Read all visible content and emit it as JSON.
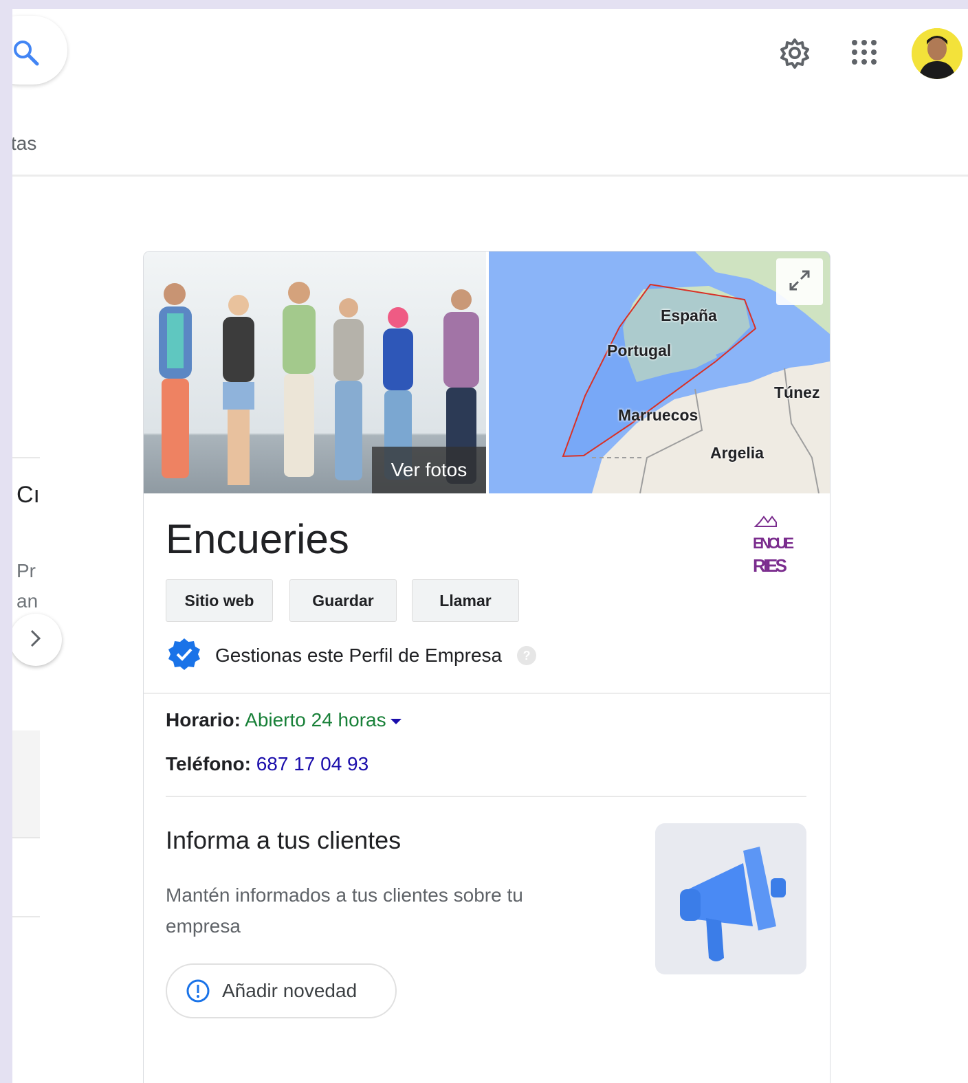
{
  "header": {
    "search_icon": "search-icon",
    "settings_icon": "gear-icon",
    "apps_icon": "apps-grid-icon",
    "tab_fragment": "tas"
  },
  "left_column": {
    "heading_fragment": "Cı",
    "line1_fragment": "Pr",
    "line2_fragment": "an",
    "next_icon": "chevron-right-icon"
  },
  "panel": {
    "photos_label": "Ver fotos",
    "map": {
      "labels": [
        "España",
        "Portugal",
        "Marruecos",
        "Túnez",
        "Argelia"
      ],
      "area_outline_color": "#d93025",
      "expand_icon": "expand-icon"
    },
    "business_name": "Encueries",
    "logo_text_top": "ENCUE",
    "logo_text_bottom": "RIES",
    "actions": [
      "Sitio web",
      "Guardar",
      "Llamar"
    ],
    "verified_text": "Gestionas este Perfil de Empresa",
    "help_icon": "?",
    "hours_label": "Horario:",
    "hours_value": "Abierto 24 horas",
    "phone_label": "Teléfono:",
    "phone_value": "687 17 04 93",
    "promo": {
      "title": "Informa a tus clientes",
      "description": "Mantén informados a tus clientes sobre tu empresa",
      "button_label": "Añadir novedad",
      "illustration_icon": "megaphone-icon"
    }
  },
  "colors": {
    "background": "#e4e1f2",
    "open_green": "#188038",
    "link_blue": "#1a0dab",
    "accent_blue": "#4285f4",
    "logo_purple": "#7b2d8e"
  }
}
